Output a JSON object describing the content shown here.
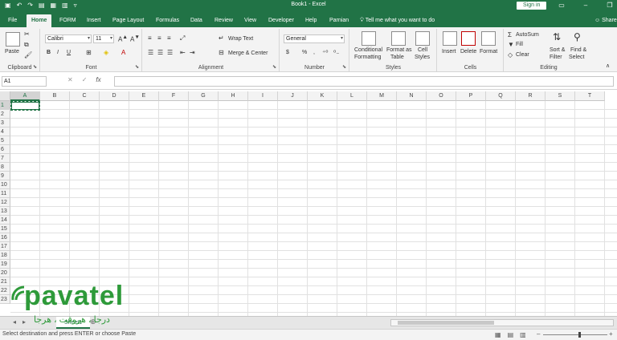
{
  "titlebar": {
    "title": "Book1 - Excel",
    "signin": "Sign in",
    "qat": [
      "save-icon",
      "undo-icon",
      "redo-icon",
      "open-icon",
      "print-icon",
      "print-preview-icon",
      "customize-icon"
    ]
  },
  "tabs": [
    "File",
    "Home",
    "FORM",
    "Insert",
    "Page Layout",
    "Formulas",
    "Data",
    "Review",
    "View",
    "Developer",
    "Help",
    "Parnian"
  ],
  "active_tab": "Home",
  "tellme": "Tell me what you want to do",
  "share": "Share",
  "ribbon": {
    "clipboard": {
      "label": "Clipboard",
      "paste": "Paste"
    },
    "font": {
      "label": "Font",
      "name": "Calibri",
      "size": "11",
      "bold": "B",
      "italic": "I",
      "underline": "U"
    },
    "alignment": {
      "label": "Alignment",
      "wrap": "Wrap Text",
      "merge": "Merge & Center"
    },
    "number": {
      "label": "Number",
      "format": "General",
      "currency": "$",
      "percent": "%",
      "comma": ","
    },
    "styles": {
      "label": "Styles",
      "conditional_1": "Conditional",
      "conditional_2": "Formatting",
      "format_as_1": "Format as",
      "format_as_2": "Table",
      "cell_styles_1": "Cell",
      "cell_styles_2": "Styles"
    },
    "cells": {
      "label": "Cells",
      "insert": "Insert",
      "delete": "Delete",
      "format": "Format"
    },
    "editing": {
      "label": "Editing",
      "autosum": "AutoSum",
      "fill": "Fill",
      "clear": "Clear",
      "sort_1": "Sort &",
      "sort_2": "Filter",
      "find_1": "Find &",
      "find_2": "Select"
    }
  },
  "formula_bar": {
    "name_box": "A1",
    "fx": "fx",
    "cancel": "✕",
    "enter": "✓",
    "value": ""
  },
  "columns": [
    "A",
    "B",
    "C",
    "D",
    "E",
    "F",
    "G",
    "H",
    "I",
    "J",
    "K",
    "L",
    "M",
    "N",
    "O",
    "P",
    "Q",
    "R",
    "S",
    "T"
  ],
  "rows": [
    "1",
    "2",
    "3",
    "4",
    "5",
    "6",
    "7",
    "8",
    "9",
    "10",
    "11",
    "12",
    "13",
    "14",
    "15",
    "16",
    "17",
    "18",
    "19",
    "20",
    "21",
    "22",
    "23"
  ],
  "selected_cell": "A1",
  "sheet_tab": "Sheet1",
  "status": "Select destination and press ENTER or choose Paste",
  "watermark": {
    "brand": "pavatel",
    "tagline": "درجا ، هروقت ، هرجا"
  },
  "colors": {
    "accent": "#217346",
    "watermark": "#2e9a3a"
  }
}
